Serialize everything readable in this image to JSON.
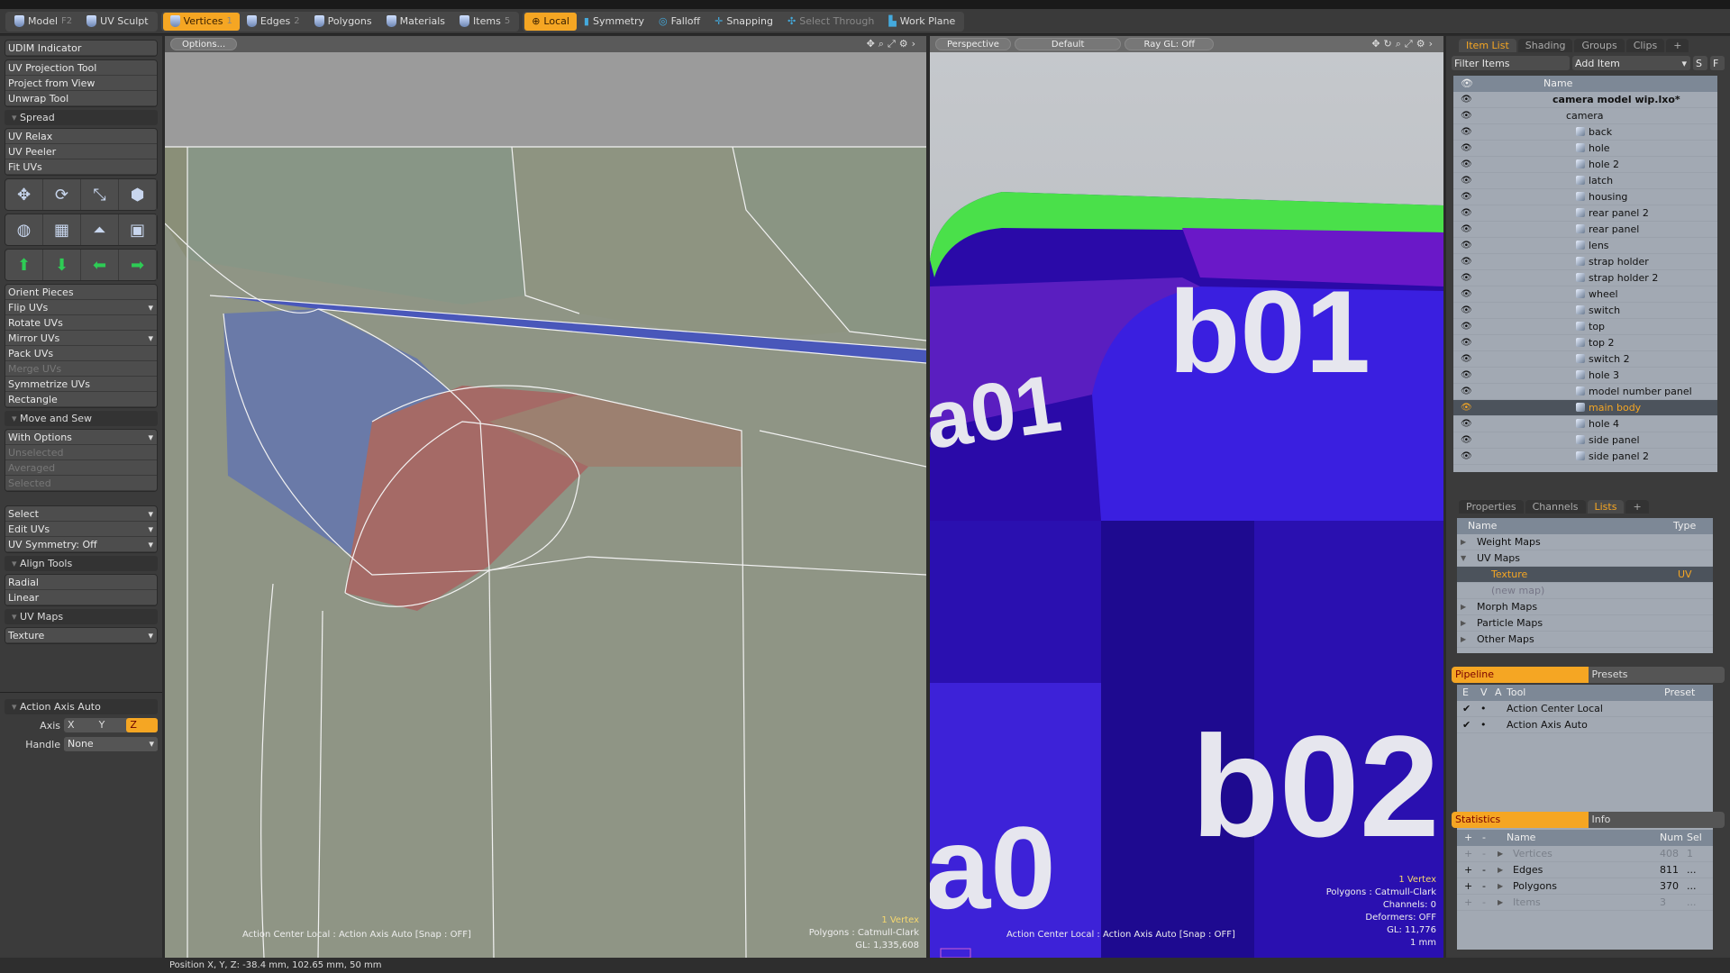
{
  "toolbar": {
    "mode_group": [
      {
        "label": "Model",
        "key": "F2"
      },
      {
        "label": "UV Sculpt",
        "key": ""
      }
    ],
    "select_group": [
      {
        "label": "Vertices",
        "key": "1",
        "on": true
      },
      {
        "label": "Edges",
        "key": "2"
      },
      {
        "label": "Polygons",
        "key": ""
      },
      {
        "label": "Materials",
        "key": ""
      },
      {
        "label": "Items",
        "key": "5"
      }
    ],
    "tools": [
      {
        "label": "Local",
        "on": true
      },
      {
        "label": "Symmetry"
      },
      {
        "label": "Falloff"
      },
      {
        "label": "Snapping"
      },
      {
        "label": "Select Through",
        "dim": true
      },
      {
        "label": "Work Plane"
      }
    ]
  },
  "left_panel": {
    "udim": "UDIM Indicator",
    "projection": [
      "UV Projection Tool",
      "Project from View",
      "Unwrap Tool"
    ],
    "spread_header": "Spread",
    "spread": [
      "UV Relax",
      "UV Peeler",
      "Fit UVs"
    ],
    "icon_rows": [
      [
        "move-icon",
        "rotate-icon",
        "scale-icon",
        "transform-icon"
      ],
      [
        "cylinder-map-icon",
        "planar-map-icon",
        "perspective-map-icon",
        "box-map-icon"
      ],
      [
        "align-top-icon",
        "align-bottom-icon",
        "align-left-icon",
        "align-right-icon"
      ]
    ],
    "orient": [
      {
        "label": "Orient Pieces"
      },
      {
        "label": "Flip UVs",
        "dd": true
      },
      {
        "label": "Rotate UVs"
      },
      {
        "label": "Mirror UVs",
        "dd": true
      },
      {
        "label": "Pack UVs"
      },
      {
        "label": "Merge UVs",
        "dim": true
      },
      {
        "label": "Symmetrize UVs"
      },
      {
        "label": "Rectangle"
      }
    ],
    "move_sew_header": "Move and Sew",
    "move_sew": [
      {
        "label": "With Options",
        "dd": true
      },
      {
        "label": "Unselected",
        "dim": true
      },
      {
        "label": "Averaged",
        "dim": true
      },
      {
        "label": "Selected",
        "dim": true
      }
    ],
    "select": [
      {
        "label": "Select",
        "dd": true
      },
      {
        "label": "Edit UVs",
        "dd": true
      },
      {
        "label": "UV Symmetry: Off",
        "dd": true
      }
    ],
    "align_header": "Align Tools",
    "align": [
      "Radial",
      "Linear"
    ],
    "uvmaps_header": "UV Maps",
    "uvmap_value": "Texture",
    "action_header": "Action Axis Auto",
    "axis_label": "Axis",
    "axis_options": [
      "X",
      "Y",
      "Z"
    ],
    "axis_selected": "Z",
    "handle_label": "Handle",
    "handle_value": "None"
  },
  "uv_viewport": {
    "options": "Options...",
    "overlay_left": "Action Center Local : Action Axis Auto  [Snap : OFF]",
    "info": [
      "1 Vertex",
      "Polygons : Catmull-Clark",
      "GL: 1,335,608"
    ]
  },
  "viewport_3d": {
    "view": "Perspective",
    "shading": "Default",
    "raygl": "Ray GL: Off",
    "labels": [
      "a01",
      "b01",
      "a0",
      "b02"
    ],
    "overlay_left": "Action Center Local : Action Axis Auto  [Snap : OFF]",
    "info": [
      "1 Vertex",
      "Polygons : Catmull-Clark",
      "Channels: 0",
      "Deformers: OFF",
      "GL: 11,776",
      "1 mm"
    ]
  },
  "item_list": {
    "tabs": [
      "Item List",
      "Shading",
      "Groups",
      "Clips",
      "+"
    ],
    "filter": "Filter Items",
    "add_item": "Add Item",
    "s": "S",
    "f": "F",
    "name_header": "Name",
    "scene": "camera model wip.lxo*",
    "group": "camera",
    "items": [
      "back",
      "hole",
      "hole 2",
      "latch",
      "housing",
      "rear panel 2",
      "rear panel",
      "lens",
      "strap holder",
      "strap holder 2",
      "wheel",
      "switch",
      "top",
      "top 2",
      "switch 2",
      "hole 3",
      "model number panel",
      "main body",
      "hole 4",
      "side panel",
      "side panel 2"
    ],
    "selected": "main body"
  },
  "lists": {
    "tabs": [
      "Properties",
      "Channels",
      "Lists",
      "+"
    ],
    "headers": [
      "Name",
      "Type"
    ],
    "rows": [
      {
        "name": "Weight Maps",
        "arrow": "▶"
      },
      {
        "name": "UV Maps",
        "arrow": "▼"
      },
      {
        "name": "Texture",
        "type": "UV",
        "sel": true,
        "indent": true
      },
      {
        "name": "(new map)",
        "dim": true,
        "indent": true
      },
      {
        "name": "Morph Maps",
        "arrow": "▶"
      },
      {
        "name": "Particle Maps",
        "arrow": "▶"
      },
      {
        "name": "Other Maps",
        "arrow": "▶"
      }
    ]
  },
  "pipeline": {
    "tabs": [
      "Pipeline",
      "Presets"
    ],
    "headers": [
      "E",
      "V",
      "A",
      "Tool",
      "Preset"
    ],
    "rows": [
      {
        "e": "✔",
        "v": "•",
        "tool": "Action Center Local"
      },
      {
        "e": "✔",
        "v": "•",
        "tool": "Action Axis Auto"
      }
    ]
  },
  "statistics": {
    "tabs": [
      "Statistics",
      "Info"
    ],
    "headers": [
      "+",
      "-",
      "Name",
      "Num",
      "Sel"
    ],
    "rows": [
      {
        "name": "Vertices",
        "num": "408",
        "sel": "1",
        "dim": true
      },
      {
        "name": "Edges",
        "num": "811",
        "sel": "..."
      },
      {
        "name": "Polygons",
        "num": "370",
        "sel": "..."
      },
      {
        "name": "Items",
        "num": "3",
        "sel": "...",
        "dim": true
      }
    ]
  },
  "status": "Position X, Y, Z:   -38.4 mm, 102.65 mm, 50 mm",
  "colors": {
    "accent": "#f5a623",
    "uv_bg": "#8f9585",
    "mesh_blue": "#3a1fd0",
    "mesh_green": "#4fe04a"
  }
}
